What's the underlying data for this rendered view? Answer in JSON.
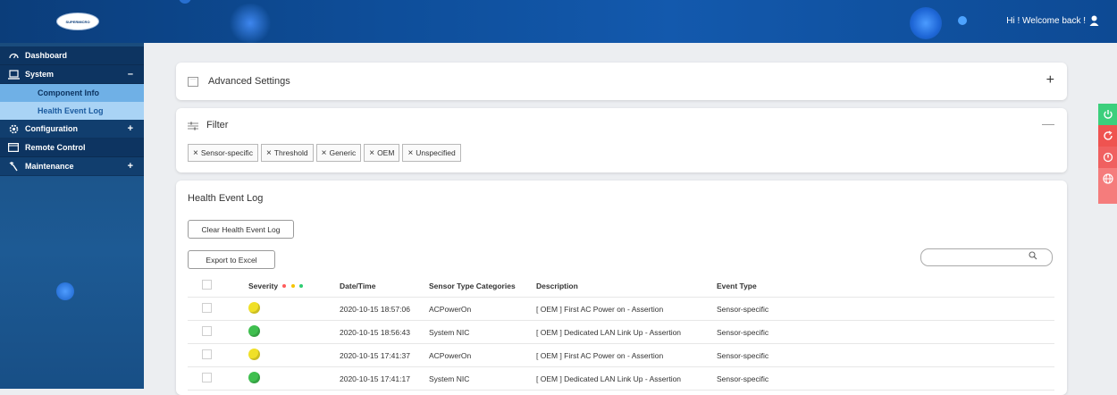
{
  "header": {
    "logo_text": "SUPERMICRO",
    "welcome": "Hi ! Welcome back !"
  },
  "sidebar": {
    "items": [
      {
        "label": "Dashboard",
        "icon": "dashboard-icon",
        "toggle": ""
      },
      {
        "label": "System",
        "icon": "laptop-icon",
        "toggle": "–"
      },
      {
        "label": "Configuration",
        "icon": "gear-icon",
        "toggle": "+"
      },
      {
        "label": "Remote Control",
        "icon": "remote-window-icon",
        "toggle": ""
      },
      {
        "label": "Maintenance",
        "icon": "wrench-icon",
        "toggle": "+"
      }
    ],
    "sub_items": [
      "Component Info",
      "Health Event Log"
    ]
  },
  "advanced": {
    "title": "Advanced Settings",
    "expand": "+"
  },
  "filter": {
    "title": "Filter",
    "collapse": "—",
    "tags": [
      "Sensor-specific",
      "Threshold",
      "Generic",
      "OEM",
      "Unspecified"
    ],
    "tag_remove": "×"
  },
  "log": {
    "title": "Health Event Log",
    "clear_label": "Clear Health Event Log",
    "export_label": "Export to Excel",
    "search_placeholder": "",
    "columns": [
      "Severity",
      "Date/Time",
      "Sensor Type Categories",
      "Description",
      "Event Type"
    ],
    "severity_dots": [
      "#ff5b5b",
      "#f5c400",
      "#2ecc71"
    ],
    "rows": [
      {
        "severity": "warning",
        "datetime": "2020-10-15 18:57:06",
        "sensor": "ACPowerOn",
        "description": "[ OEM ] First AC Power on - Assertion",
        "event_type": "Sensor-specific"
      },
      {
        "severity": "ok",
        "datetime": "2020-10-15 18:56:43",
        "sensor": "System NIC",
        "description": "[ OEM ] Dedicated LAN Link Up - Assertion",
        "event_type": "Sensor-specific"
      },
      {
        "severity": "warning",
        "datetime": "2020-10-15 17:41:37",
        "sensor": "ACPowerOn",
        "description": "[ OEM ] First AC Power on - Assertion",
        "event_type": "Sensor-specific"
      },
      {
        "severity": "ok",
        "datetime": "2020-10-15 17:41:17",
        "sensor": "System NIC",
        "description": "[ OEM ] Dedicated LAN Link Up - Assertion",
        "event_type": "Sensor-specific"
      }
    ]
  },
  "colors": {
    "warning": "#f0e028",
    "ok": "#3fbf4f",
    "power_on": "#3ccf7c",
    "reset": "#ef5350",
    "power_off": "#f06060",
    "web": "#f57c7c"
  },
  "side_buttons": [
    "power-on-icon",
    "reset-icon",
    "power-off-icon",
    "globe-icon"
  ]
}
